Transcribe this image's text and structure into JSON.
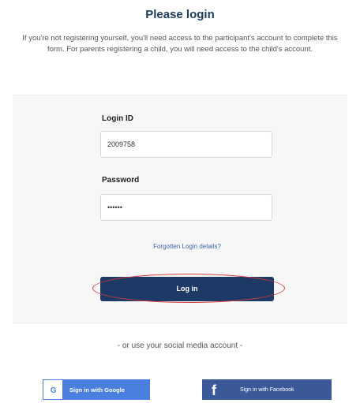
{
  "header": {
    "title": "Please login",
    "intro": "If you're not registering yourself, you'll need access to the participant's account to complete this form. For parents registering a child, you will need access to the child's account."
  },
  "login_form": {
    "login_id_label": "Login ID",
    "login_id_value": "2009758",
    "password_label": "Password",
    "password_value": "••••••",
    "forgot_link": "Forgotten Login details?",
    "login_button": "Log in"
  },
  "social": {
    "divider_text": "- or use your social media account -",
    "google_button": "Sign in with Google",
    "facebook_button": "Sign in with Facebook"
  },
  "colors": {
    "primary_navy": "#1d3966",
    "google_blue": "#4a7fe0",
    "facebook_blue": "#3b5998",
    "highlight_red": "#d83a3a"
  }
}
